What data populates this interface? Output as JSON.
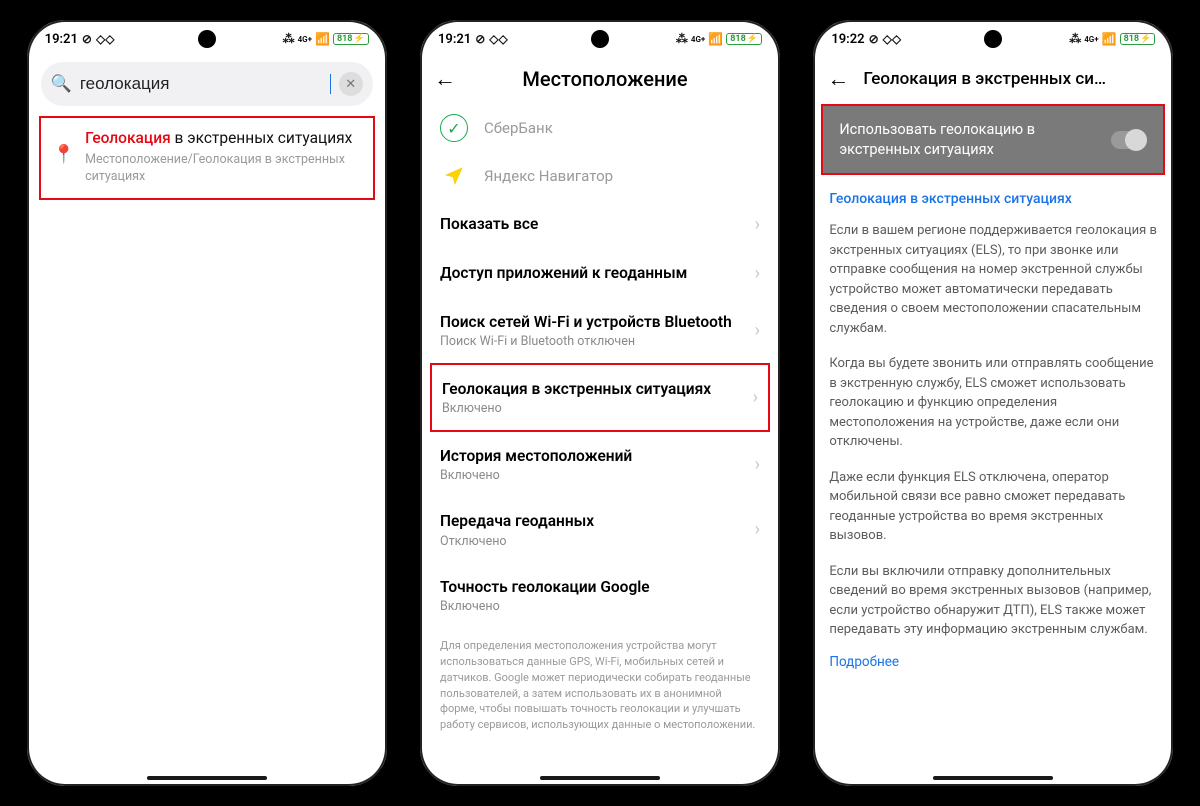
{
  "status": {
    "time1": "19:21",
    "time2": "19:21",
    "time3": "19:22",
    "battery": "818",
    "bt": "✱",
    "net": "4G+"
  },
  "screen1": {
    "search_value": "геолокация",
    "result_highlight": "Геолокация",
    "result_rest": " в экстренных ситуациях",
    "result_sub": "Местоположение/Геолокация в экстренных ситуациях"
  },
  "screen2": {
    "title": "Местоположение",
    "apps": {
      "sber": "СберБанк",
      "yandex": "Яндекс Навигатор"
    },
    "menu": {
      "show_all": "Показать все",
      "app_access": "Доступ приложений к геоданным",
      "wifi_bt": "Поиск сетей Wi-Fi и устройств Bluetooth",
      "wifi_bt_sub": "Поиск Wi-Fi и Bluetooth отключен",
      "els": "Геолокация в экстренных ситуациях",
      "els_sub": "Включено",
      "history": "История местоположений",
      "history_sub": "Включено",
      "share": "Передача геоданных",
      "share_sub": "Отключено",
      "accuracy": "Точность геолокации Google",
      "accuracy_sub": "Включено"
    },
    "footer": "Для определения местоположения устройства могут использоваться данные GPS, Wi-Fi, мобильных сетей и датчиков. Google может периодически собирать геоданные пользователей, а затем использовать их в анонимной форме, чтобы повышать точность геолокации и улучшать работу сервисов, использующих данные о местоположении."
  },
  "screen3": {
    "title": "Геолокация в экстренных си…",
    "toggle_label": "Использовать геолокацию в экстренных ситуациях",
    "section": "Геолокация в экстренных ситуациях",
    "p1": "Если в вашем регионе поддерживается геолокация в экстренных ситуациях (ELS), то при звонке или отправке сообщения на номер экстренной службы устройство может автоматически передавать сведения о своем местоположении спасательным службам.",
    "p2": "Когда вы будете звонить или отправлять сообщение в экстренную службу, ELS сможет использовать геолокацию и функцию определения местоположения на устройстве, даже если они отключены.",
    "p3": "Даже если функция ELS отключена, оператор мобильной связи все равно сможет передавать геоданные устройства во время экстренных вызовов.",
    "p4": "Если вы включили отправку дополнительных сведений во время экстренных вызовов (например, если устройство обнаружит ДТП), ELS также может передавать эту информацию экстренным службам.",
    "more": "Подробнее"
  }
}
